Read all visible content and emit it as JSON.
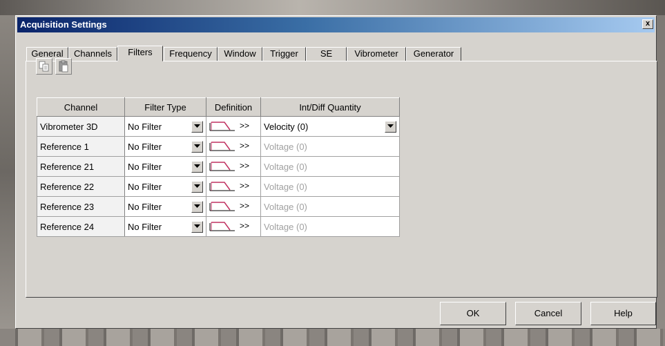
{
  "window": {
    "title": "Acquisition Settings",
    "close_label": "x"
  },
  "tabs": [
    {
      "label": "General"
    },
    {
      "label": "Channels"
    },
    {
      "label": "Filters"
    },
    {
      "label": "Frequency"
    },
    {
      "label": "Window"
    },
    {
      "label": "Trigger"
    },
    {
      "label": "SE"
    },
    {
      "label": "Vibrometer"
    },
    {
      "label": "Generator"
    }
  ],
  "active_tab": "Filters",
  "toolbar": {
    "icons": [
      "copy-icon",
      "paste-icon"
    ]
  },
  "table": {
    "headers": {
      "channel": "Channel",
      "filter_type": "Filter Type",
      "definition": "Definition",
      "quantity": "Int/Diff Quantity"
    },
    "definition_arrows": ">>",
    "rows": [
      {
        "channel": "Vibrometer 3D",
        "filter_type": "No Filter",
        "quantity": "Velocity (0)",
        "quantity_enabled": true
      },
      {
        "channel": "Reference 1",
        "filter_type": "No Filter",
        "quantity": "Voltage (0)",
        "quantity_enabled": false
      },
      {
        "channel": "Reference 21",
        "filter_type": "No Filter",
        "quantity": "Voltage (0)",
        "quantity_enabled": false
      },
      {
        "channel": "Reference 22",
        "filter_type": "No Filter",
        "quantity": "Voltage (0)",
        "quantity_enabled": false
      },
      {
        "channel": "Reference 23",
        "filter_type": "No Filter",
        "quantity": "Voltage (0)",
        "quantity_enabled": false
      },
      {
        "channel": "Reference 24",
        "filter_type": "No Filter",
        "quantity": "Voltage (0)",
        "quantity_enabled": false
      }
    ]
  },
  "buttons": {
    "ok": "OK",
    "cancel": "Cancel",
    "help": "Help"
  },
  "colors": {
    "titlebar_start": "#0a246a",
    "titlebar_end": "#a6caf0",
    "filter_curve": "#c03060",
    "disabled_text": "#a0a0a0"
  }
}
